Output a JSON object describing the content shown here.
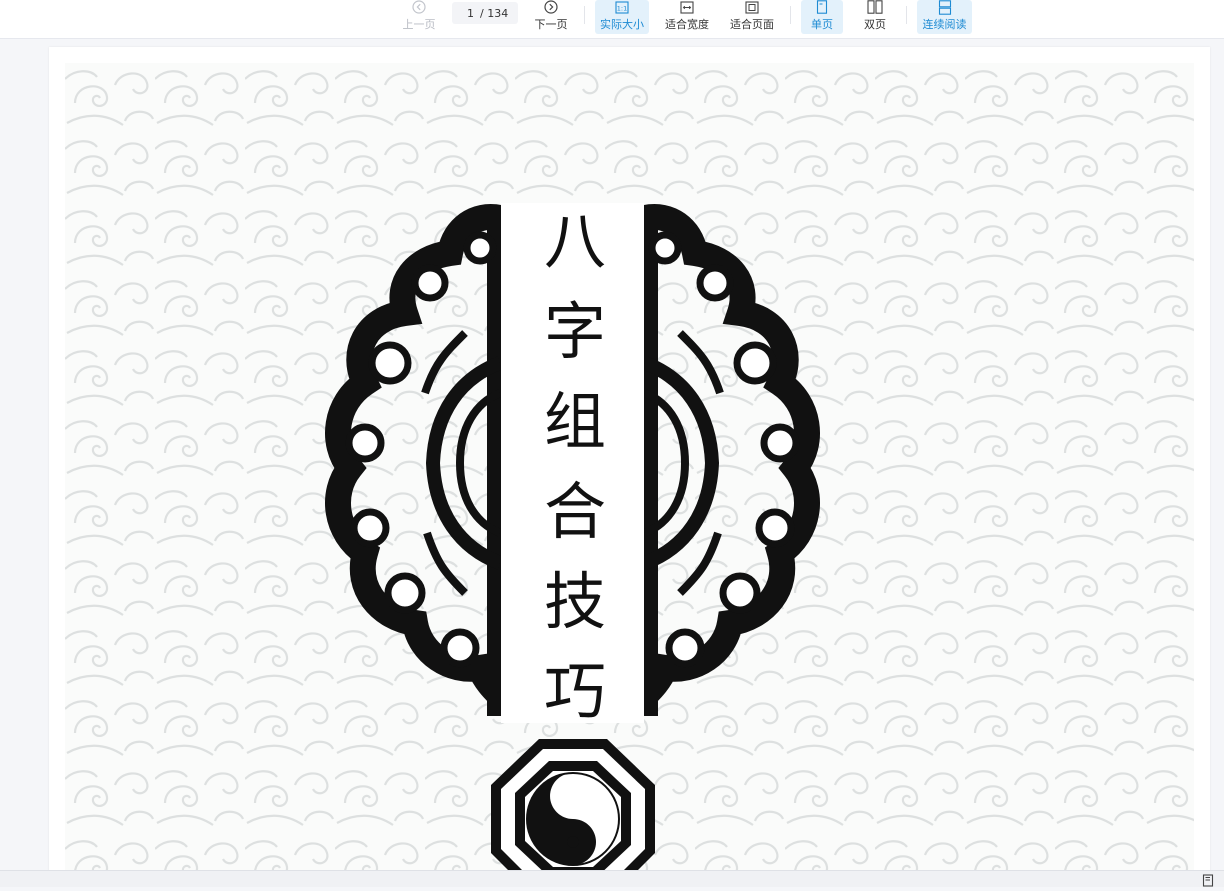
{
  "toolbar": {
    "prev_label": "上一页",
    "next_label": "下一页",
    "current_page": "1",
    "total_pages": "/ 134",
    "actual_size_label": "实际大小",
    "fit_width_label": "适合宽度",
    "fit_page_label": "适合页面",
    "single_page_label": "单页",
    "double_page_label": "双页",
    "continuous_label": "连续阅读"
  },
  "document": {
    "title_chars": [
      "八",
      "字",
      "组",
      "合",
      "技",
      "巧"
    ]
  },
  "colors": {
    "accent": "#1e8bd3",
    "active_bg": "#e3f1fb",
    "ink": "#111111",
    "pattern": "#dcdfe1"
  }
}
